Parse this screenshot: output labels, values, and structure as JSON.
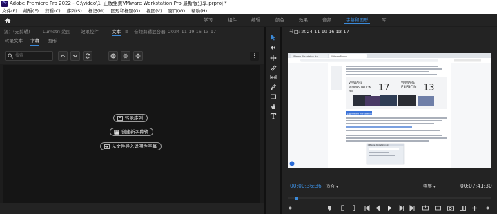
{
  "title_bar": {
    "app_badge": "Pr",
    "text": "Adobe Premiere Pro 2022 - G:\\video\\1_正版免费VMware Workstation Pro 最新版分享.prproj *"
  },
  "menu": [
    "文件(F)",
    "编辑(E)",
    "剪辑(C)",
    "序列(S)",
    "标记(M)",
    "图形和标题(G)",
    "视图(V)",
    "窗口(W)",
    "帮助(H)"
  ],
  "workspaces": [
    "学习",
    "组件",
    "编辑",
    "颜色",
    "效果",
    "音频",
    "字幕和图形",
    "库"
  ],
  "active_workspace": "字幕和图形",
  "left_panel": {
    "tabs": [
      "源：(无剪辑)",
      "Lumetri 范围",
      "效果控件",
      "文本",
      "≡",
      "音频剪辑混合器: 2024-11-19 16-13-17"
    ],
    "active_tab": "文本",
    "subtabs": [
      "转录文本",
      "字幕",
      "图形"
    ],
    "active_subtab": "字幕",
    "search_placeholder": "搜索",
    "more_label": "⋮",
    "buttons": {
      "transcribe": "转录序列",
      "create_track": "创建新字幕轨",
      "import": "从文件导入说明性字幕"
    }
  },
  "program_monitor": {
    "title": "节目: 2024-11-19 16-13-17",
    "menu_glyph": "≡",
    "timecode_current": "00:00:36:36",
    "fit_label": "适合",
    "quality_label": "完整",
    "timecode_total": "00:07:41:30",
    "timecode_color": "#3b8ad9"
  },
  "video_content": {
    "browser_tab_1": "VMware Workstation Pro",
    "browser_tab_2": "VMware Fusion",
    "heading_left_label": "WORKSTATION",
    "heading_left_sub": "PRO",
    "heading_left_ver": "17",
    "heading_right_label": "FUSION",
    "heading_right_ver": "13",
    "vmware_word": "VMWARE",
    "highlight": "正版VMware Workstation Pro",
    "dialog_title": "VMware Workstation 17"
  },
  "colors": {
    "accent": "#3b8ad9",
    "panel": "#232323",
    "body": "#151515"
  }
}
